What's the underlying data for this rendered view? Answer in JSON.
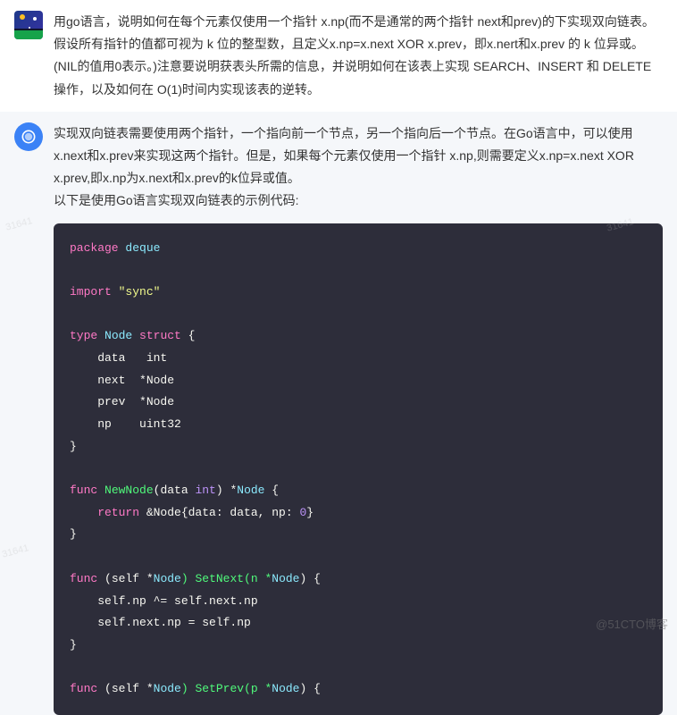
{
  "user_message": "用go语言，说明如何在每个元素仅使用一个指针 x.np(而不是通常的两个指针 next和prev)的下实现双向链表。假设所有指针的值都可视为 k 位的整型数，且定义x.np=x.next XOR x.prev，即x.nert和x.prev 的 k 位异或。(NIL的值用0表示。)注意要说明获表头所需的信息，并说明如何在该表上实现 SEARCH、INSERT 和 DELETE操作，以及如何在 O(1)时间内实现该表的逆转。",
  "assistant_intro": "实现双向链表需要使用两个指针，一个指向前一个节点，另一个指向后一个节点。在Go语言中，可以使用x.next和x.prev来实现这两个指针。但是，如果每个元素仅使用一个指针 x.np,则需要定义x.np=x.next XOR x.prev,即x.np为x.next和x.prev的k位异或值。",
  "assistant_intro2": "以下是使用Go语言实现双向链表的示例代码:",
  "code": {
    "l1_kw": "package",
    "l1_id": " deque",
    "l2_kw": "import",
    "l2_str": " \"sync\"",
    "l3_kw": "type",
    "l3_id": " Node",
    "l3_struct": " struct",
    "l3_brace": " {",
    "l4": "    data   int",
    "l5": "    next  *Node",
    "l6": "    prev  *Node",
    "l7": "    np    uint32",
    "l8": "}",
    "l9_kw": "func",
    "l9_name": " NewNode",
    "l9_params": "(data ",
    "l9_type": "int",
    "l9_ret": ") *",
    "l9_rettype": "Node",
    "l9_brace": " {",
    "l10_kw": "    return",
    "l10_rest": " &Node{data: data, np: ",
    "l10_num": "0",
    "l10_end": "}",
    "l11": "}",
    "l12_kw": "func",
    "l12_rest": " (self *",
    "l12_type": "Node",
    "l12_name": ") SetNext(n *",
    "l12_type2": "Node",
    "l12_end": ") {",
    "l13": "    self.np ^= self.next.np",
    "l14": "    self.next.np = self.np",
    "l15": "}",
    "l16_kw": "func",
    "l16_rest": " (self *",
    "l16_type": "Node",
    "l16_name": ") SetPrev(p *",
    "l16_type2": "Node",
    "l16_end": ") {"
  },
  "watermark": "@51CTO博客",
  "watermark_bg": "31641"
}
